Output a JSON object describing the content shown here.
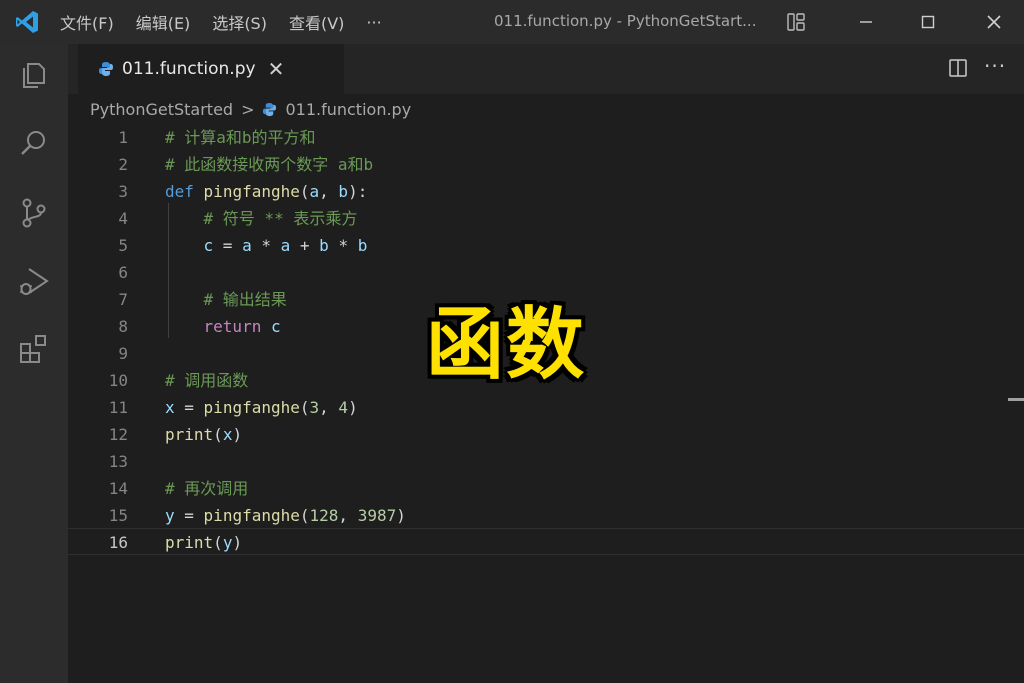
{
  "window": {
    "title": "011.function.py - PythonGetStart...",
    "menu": [
      "文件(F)",
      "编辑(E)",
      "选择(S)",
      "查看(V)",
      "···"
    ]
  },
  "activity_bar": [
    "explorer-icon",
    "search-icon",
    "source-control-icon",
    "run-debug-icon",
    "extensions-icon"
  ],
  "tab": {
    "label": "011.function.py",
    "close": "✕"
  },
  "breadcrumb": {
    "folder": "PythonGetStarted",
    "separator": ">",
    "file": "011.function.py"
  },
  "editor": {
    "active_line": 16,
    "line_numbers": [
      "1",
      "2",
      "3",
      "4",
      "5",
      "6",
      "7",
      "8",
      "9",
      "10",
      "11",
      "12",
      "13",
      "14",
      "15",
      "16"
    ],
    "code": {
      "l1": "# 计算a和b的平方和",
      "l2": "# 此函数接收两个数字 a和b",
      "l3_kw": "def",
      "l3_fn": "pingfanghe",
      "l3_a": "a",
      "l3_b": "b",
      "l4": "# 符号 ** 表示乘方",
      "l5_c": "c",
      "l5_a1": "a",
      "l5_a2": "a",
      "l5_b1": "b",
      "l5_b2": "b",
      "l7": "# 输出结果",
      "l8_kw": "return",
      "l8_c": "c",
      "l10": "# 调用函数",
      "l11_x": "x",
      "l11_fn": "pingfanghe",
      "l11_n1": "3",
      "l11_n2": "4",
      "l12_fn": "print",
      "l12_x": "x",
      "l14": "# 再次调用",
      "l15_y": "y",
      "l15_fn": "pingfanghe",
      "l15_n1": "128",
      "l15_n2": "3987",
      "l16_fn": "print",
      "l16_y": "y"
    }
  },
  "overlay_caption": "函数",
  "colors": {
    "comment": "#6a9955",
    "keyword": "#569cd6",
    "function": "#dcdcaa",
    "variable": "#9cdcfe",
    "number": "#b5cea8",
    "caption": "#ffe100"
  }
}
